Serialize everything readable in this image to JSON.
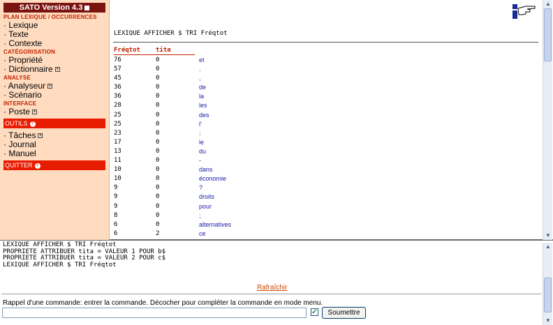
{
  "sidebar": {
    "title": "SATO Version 4.3",
    "sections": [
      {
        "label": "PLAN LEXIQUE / OCCURRENCES",
        "items": [
          {
            "label": "· Lexique"
          },
          {
            "label": "· Texte"
          },
          {
            "label": "· Contexte"
          }
        ]
      },
      {
        "label": "CATÉGORISATION",
        "items": [
          {
            "label": "· Propriété"
          },
          {
            "label": "· Dictionnaire"
          }
        ]
      },
      {
        "label": "ANALYSE",
        "items": [
          {
            "label": "· Analyseur"
          },
          {
            "label": "· Scénario"
          }
        ]
      },
      {
        "label": "INTERFACE",
        "items": [
          {
            "label": "· Poste"
          }
        ]
      }
    ],
    "outils_label": "OUTILS",
    "outils_items": [
      {
        "label": "· Tâches"
      },
      {
        "label": "· Journal"
      },
      {
        "label": "· Manuel"
      }
    ],
    "quitter_label": "QUITTER"
  },
  "main": {
    "command_title": "LEXIQUE AFFICHER $ TRI Fréqtot",
    "columns": [
      "Fréqtot",
      "tita"
    ],
    "rows": [
      {
        "freq": "76",
        "tita": "0",
        "word": "et"
      },
      {
        "freq": "57",
        "tita": "0",
        "word": "."
      },
      {
        "freq": "45",
        "tita": "0",
        "word": ","
      },
      {
        "freq": "36",
        "tita": "0",
        "word": "de"
      },
      {
        "freq": "36",
        "tita": "0",
        "word": "la"
      },
      {
        "freq": "28",
        "tita": "0",
        "word": "les"
      },
      {
        "freq": "25",
        "tita": "0",
        "word": "des"
      },
      {
        "freq": "25",
        "tita": "0",
        "word": "l'"
      },
      {
        "freq": "23",
        "tita": "0",
        "word": ":"
      },
      {
        "freq": "17",
        "tita": "0",
        "word": "le"
      },
      {
        "freq": "13",
        "tita": "0",
        "word": "du"
      },
      {
        "freq": "11",
        "tita": "0",
        "word": "-"
      },
      {
        "freq": "10",
        "tita": "0",
        "word": "dans"
      },
      {
        "freq": "10",
        "tita": "0",
        "word": "économie"
      },
      {
        "freq": "9",
        "tita": "0",
        "word": "?"
      },
      {
        "freq": "9",
        "tita": "0",
        "word": "droits"
      },
      {
        "freq": "9",
        "tita": "0",
        "word": "pour"
      },
      {
        "freq": "8",
        "tita": "0",
        "word": ";"
      },
      {
        "freq": "6",
        "tita": "0",
        "word": "alternatives"
      },
      {
        "freq": "6",
        "tita": "2",
        "word": "ce"
      }
    ]
  },
  "console": {
    "lines": [
      "LEXIQUE AFFICHER $ TRI Fréqtot",
      "PROPRIETE ATTRIBUER tita = VALEUR 1 POUR b$",
      "PROPRIETE ATTRIBUER tita = VALEUR 2 POUR c$",
      "LEXIQUE AFFICHER $ TRI Fréqtot"
    ],
    "refresh_label": "Rafraîchir",
    "hint": "Rappel d'une commande: entrer la commande. Décocher pour compléter la commande en mode menu.",
    "input_value": "",
    "submit_label": "Soumettre"
  },
  "colors": {
    "title_bg": "#7a1410",
    "section": "#c02000",
    "sidebar_bg": "#ffdcc0",
    "menu_red": "#e81c00",
    "word": "#1a1aa8"
  },
  "icons": [
    "pointing-hand-icon",
    "check-icon",
    "plus-icon",
    "help-icon",
    "close-icon"
  ]
}
